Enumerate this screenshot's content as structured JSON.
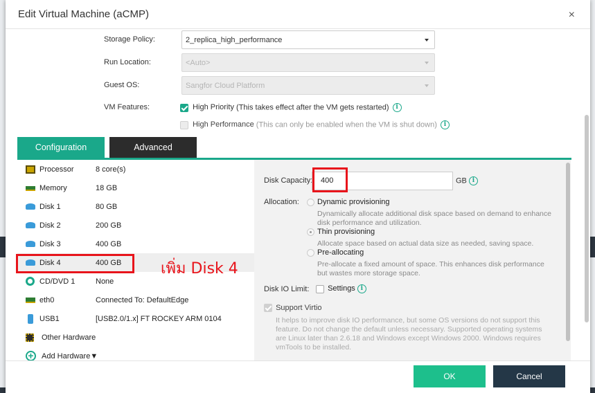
{
  "dialog": {
    "title": "Edit Virtual Machine (aCMP)",
    "close_glyph": "×"
  },
  "form": {
    "storage_policy": {
      "label": "Storage Policy:",
      "value": "2_replica_high_performance"
    },
    "run_location": {
      "label": "Run Location:",
      "value": "<Auto>"
    },
    "guest_os": {
      "label": "Guest OS:",
      "value": "Sangfor Cloud Platform"
    },
    "vm_features": {
      "label": "VM Features:",
      "high_priority": {
        "label": "High Priority",
        "note": "(This takes effect after the VM gets restarted)",
        "checked": true
      },
      "high_performance": {
        "label": "High Performance",
        "note": "(This can only be enabled when the VM is shut down)",
        "checked": false
      }
    }
  },
  "tabs": [
    {
      "label": "Configuration",
      "active": true
    },
    {
      "label": "Advanced",
      "active": false
    }
  ],
  "hardware": [
    {
      "name": "Processor",
      "value": "8 core(s)",
      "icon": "processor-icon"
    },
    {
      "name": "Memory",
      "value": "18 GB",
      "icon": "memory-icon"
    },
    {
      "name": "Disk 1",
      "value": "80 GB",
      "icon": "disk-icon"
    },
    {
      "name": "Disk 2",
      "value": "200 GB",
      "icon": "disk-icon"
    },
    {
      "name": "Disk 3",
      "value": "400 GB",
      "icon": "disk-icon"
    },
    {
      "name": "Disk 4",
      "value": "400 GB",
      "icon": "disk-icon"
    },
    {
      "name": "CD/DVD 1",
      "value": "None",
      "icon": "cd-dvd-icon"
    },
    {
      "name": "eth0",
      "value": "Connected To: DefaultEdge",
      "icon": "network-icon"
    },
    {
      "name": "USB1",
      "value": "[USB2.0/1.x] FT ROCKEY ARM 0104",
      "icon": "usb-icon"
    },
    {
      "name": "Other Hardware",
      "value": "",
      "icon": "other-hardware-icon"
    },
    {
      "name": "Add Hardware▼",
      "value": "",
      "icon": "add-icon"
    }
  ],
  "annotation": "เพิ่ม Disk 4",
  "disk": {
    "capacity_label": "Disk Capacity:",
    "capacity_value": "400",
    "unit": "GB",
    "allocation_label": "Allocation:",
    "options": [
      {
        "label": "Dynamic provisioning",
        "desc1": "Dynamically allocate additional disk space based on demand to enhance",
        "desc2": "disk performance and utilization."
      },
      {
        "label": "Thin provisioning",
        "desc1": "Allocate space based on actual data size as needed, saving space.",
        "desc2": ""
      },
      {
        "label": "Pre-allocating",
        "desc1": "Pre-allocate a fixed amount of space. This enhances disk performance",
        "desc2": "but wastes more storage space."
      }
    ],
    "selected_option": "Thin provisioning",
    "io_limit_label": "Disk IO Limit:",
    "io_settings_label": "Settings",
    "virtio_label": "Support Virtio",
    "virtio_desc": [
      "It helps to improve disk IO performance, but some OS versions do not support this",
      "feature. Do not change the default unless necessary. Supported operating systems",
      "are Linux later than 2.6.18 and Windows except Windows 2000. Windows requires",
      "vmTools to be installed."
    ]
  },
  "footer": {
    "ok_label": "OK",
    "cancel_label": "Cancel"
  },
  "colors": {
    "accent": "#1aa88a",
    "ok": "#1dbf8c",
    "cancel": "#243747",
    "annotation": "#e8141b"
  }
}
